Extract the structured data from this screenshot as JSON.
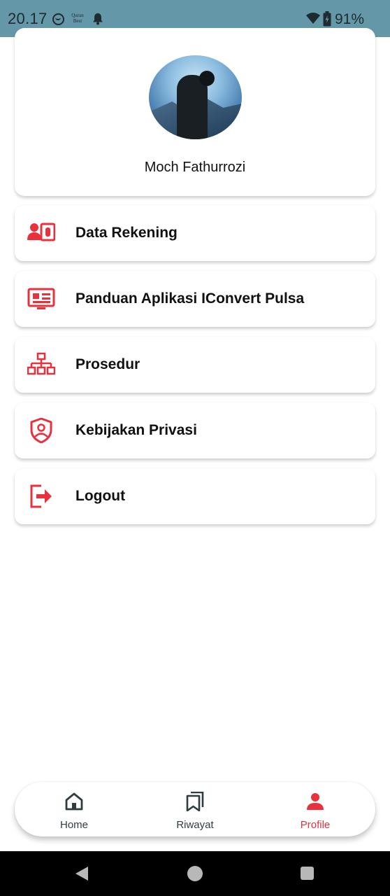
{
  "status_bar": {
    "time": "20.17",
    "quran_line1": "Quran",
    "quran_line2": "Best",
    "battery": "91%"
  },
  "profile": {
    "name": "Moch Fathurrozi"
  },
  "menu": [
    {
      "label": "Data Rekening",
      "icon": "account-card-icon"
    },
    {
      "label": "Panduan Aplikasi IConvert Pulsa",
      "icon": "guide-monitor-icon"
    },
    {
      "label": "Prosedur",
      "icon": "sitemap-icon"
    },
    {
      "label": "Kebijakan Privasi",
      "icon": "privacy-shield-icon"
    },
    {
      "label": "Logout",
      "icon": "logout-icon"
    }
  ],
  "bottom_nav": {
    "items": [
      {
        "label": "Home",
        "icon": "home-icon",
        "active": false
      },
      {
        "label": "Riwayat",
        "icon": "bookmarks-icon",
        "active": false
      },
      {
        "label": "Profile",
        "icon": "person-icon",
        "active": true
      }
    ]
  },
  "colors": {
    "accent": "#e8313c",
    "status_bar": "#6497a8",
    "nav_inactive": "#2f3d40"
  }
}
